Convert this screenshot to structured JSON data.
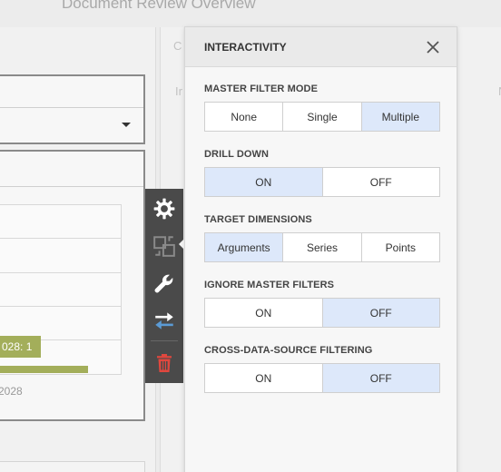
{
  "dashboard": {
    "title": "Document Review Overview",
    "ghost_letters": [
      "C",
      "Ir",
      "N"
    ],
    "chart": {
      "tooltip": "028: 1",
      "axis_label": "2028",
      "bar_fraction": 0.62,
      "bar_color": "#a3ae5a"
    }
  },
  "toolbar": {
    "items": [
      {
        "icon": "gear-icon",
        "color": "#ffffff"
      },
      {
        "icon": "interactivity-icon",
        "color": "#7a7a7a"
      },
      {
        "icon": "wrench-icon",
        "color": "#ffffff"
      },
      {
        "icon": "convert-arrows-icon",
        "color": "#ffffff"
      },
      {
        "icon": "trash-icon",
        "color": "#e0473e"
      }
    ]
  },
  "panel": {
    "title": "INTERACTIVITY",
    "close_icon": "close-icon",
    "sections": [
      {
        "label": "MASTER FILTER MODE",
        "options": [
          "None",
          "Single",
          "Multiple"
        ],
        "selected": 2
      },
      {
        "label": "DRILL DOWN",
        "options": [
          "ON",
          "OFF"
        ],
        "selected": 0
      },
      {
        "label": "TARGET DIMENSIONS",
        "options": [
          "Arguments",
          "Series",
          "Points"
        ],
        "selected": 0
      },
      {
        "label": "IGNORE MASTER FILTERS",
        "options": [
          "ON",
          "OFF"
        ],
        "selected": 1
      },
      {
        "label": "CROSS-DATA-SOURCE FILTERING",
        "options": [
          "ON",
          "OFF"
        ],
        "selected": 1
      }
    ]
  },
  "colors": {
    "selected_option": "#dde8fa",
    "toolbar_bg": "#4a4a4a",
    "delete_accent": "#e0473e"
  }
}
